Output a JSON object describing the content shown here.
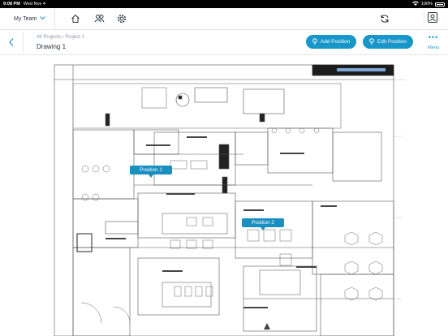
{
  "status_bar": {
    "time": "9:08 PM",
    "date": "Wed Nov 4",
    "battery": "100%"
  },
  "topnav": {
    "team_label": "My Team",
    "icons": [
      "home-icon",
      "people-icon",
      "gear-icon",
      "refresh-icon",
      "profile-icon"
    ]
  },
  "subbar": {
    "breadcrumb": "All Projects › Project 1",
    "title": "Drawing 1",
    "add_position_label": "Add Position",
    "edit_position_label": "Edit Position",
    "menu_label": "Menu"
  },
  "markers": [
    {
      "label": "Position 1"
    },
    {
      "label": "Position 2"
    }
  ],
  "colors": {
    "accent": "#1796c9",
    "text": "#2a3540",
    "muted": "#8a96a3"
  }
}
